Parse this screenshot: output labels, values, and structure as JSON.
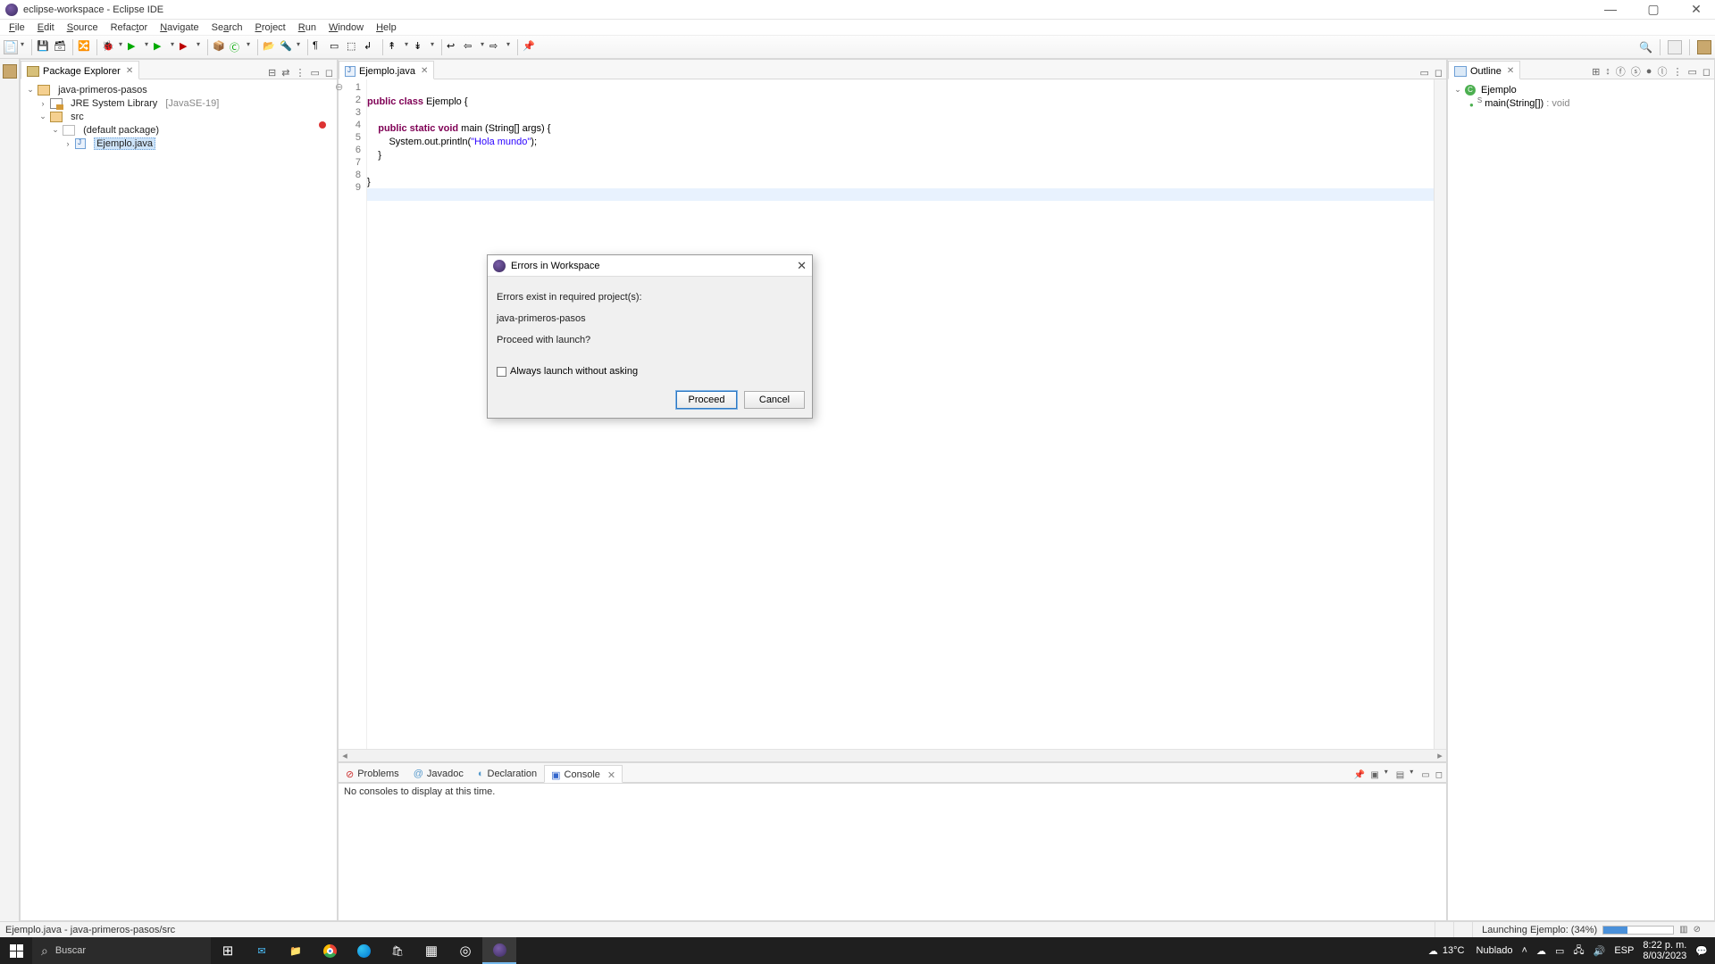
{
  "window": {
    "title": "eclipse-workspace - Eclipse IDE"
  },
  "menu": {
    "file": "File",
    "edit": "Edit",
    "source": "Source",
    "refactor": "Refactor",
    "navigate": "Navigate",
    "search": "Search",
    "project": "Project",
    "run": "Run",
    "window": "Window",
    "help": "Help"
  },
  "pkg_explorer": {
    "title": "Package Explorer",
    "project": "java-primeros-pasos",
    "jre": "JRE System Library",
    "jre_suffix": "[JavaSE-19]",
    "src": "src",
    "default_pkg": "(default package)",
    "file": "Ejemplo.java"
  },
  "editor": {
    "tab": "Ejemplo.java",
    "lines": [
      "1",
      "2",
      "3",
      "4",
      "5",
      "6",
      "7",
      "8",
      "9"
    ],
    "code": {
      "l2_a": "public",
      "l2_b": " class",
      "l2_c": " Ejemplo {",
      "l4_a": "    public",
      "l4_b": " static",
      "l4_c": " void",
      "l4_d": " main (String[] args) {",
      "l5_a": "        System.out.println(",
      "l5_b": "\"Hola mundo\"",
      "l5_c": ");",
      "l6": "    }",
      "l8": "}"
    }
  },
  "outline": {
    "title": "Outline",
    "class": "Ejemplo",
    "method": "main(String[])",
    "ret": " : void"
  },
  "bottom": {
    "tabs": {
      "problems": "Problems",
      "javadoc": "Javadoc",
      "declaration": "Declaration",
      "console": "Console"
    },
    "empty": "No consoles to display at this time."
  },
  "dialog": {
    "title": "Errors in Workspace",
    "line1": "Errors exist in required project(s):",
    "line2": "java-primeros-pasos",
    "line3": "Proceed with launch?",
    "checkbox": "Always launch without asking",
    "proceed": "Proceed",
    "cancel": "Cancel"
  },
  "status": {
    "path": "Ejemplo.java - java-primeros-pasos/src",
    "launch": "Launching Ejemplo: (34%)"
  },
  "taskbar": {
    "search": "Buscar",
    "weather_temp": "13°C",
    "weather_cond": "Nublado",
    "lang": "ESP",
    "time": "8:22 p. m.",
    "date": "8/03/2023"
  }
}
